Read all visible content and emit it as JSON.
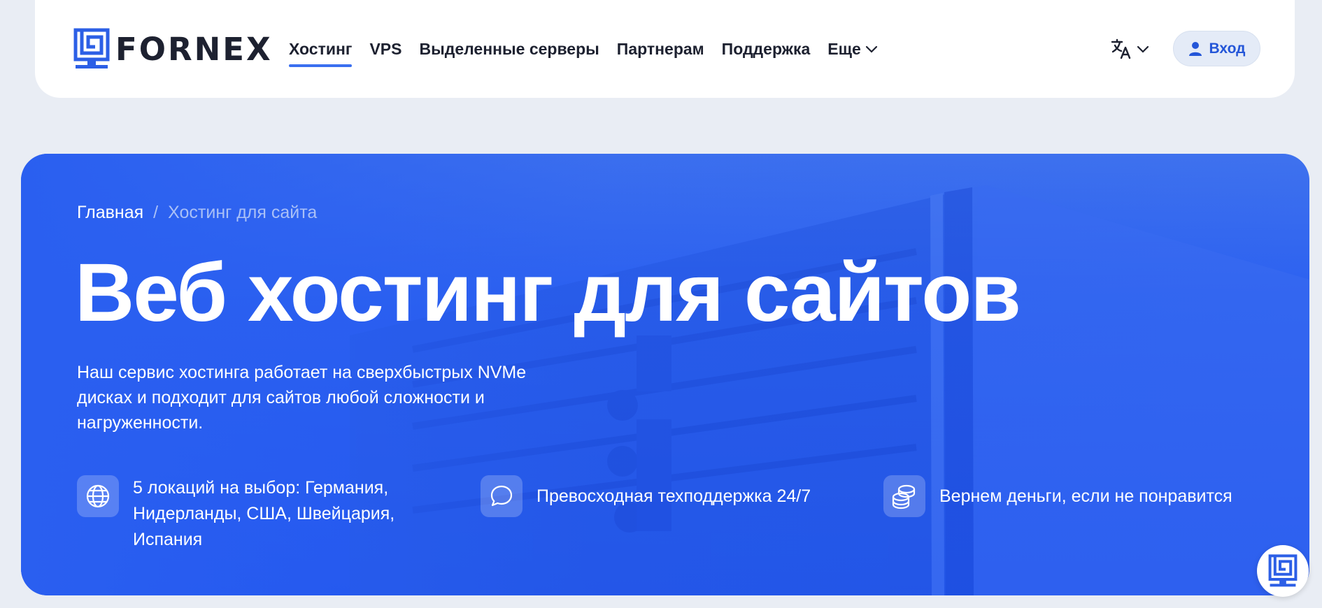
{
  "brand": {
    "name": "FORNEX",
    "accent": "#3a6ff0",
    "hero_color": "#2458ee"
  },
  "nav": {
    "items": [
      {
        "label": "Хостинг",
        "active": true
      },
      {
        "label": "VPS"
      },
      {
        "label": "Выделенные серверы"
      },
      {
        "label": "Партнерам"
      },
      {
        "label": "Поддержка"
      }
    ],
    "more_label": "Еще"
  },
  "header": {
    "lang_icon": "translate-icon",
    "login_label": "Вход"
  },
  "hero": {
    "breadcrumb": {
      "home": "Главная",
      "separator": "/",
      "current": "Хостинг для сайта"
    },
    "title": "Веб хостинг для сайтов",
    "description": "Наш сервис хостинга работает на сверхбыстрых NVMe дисках и подходит для сайтов любой сложности и нагруженности.",
    "features": [
      {
        "icon": "globe-icon",
        "text": "5 локаций на выбор: Германия, Нидерланды, США, Швейцария, Испания"
      },
      {
        "icon": "chat-bubble-icon",
        "text": "Превосходная техподдержка 24/7"
      },
      {
        "icon": "coins-icon",
        "text": "Вернем деньги, если не понравится"
      }
    ]
  }
}
